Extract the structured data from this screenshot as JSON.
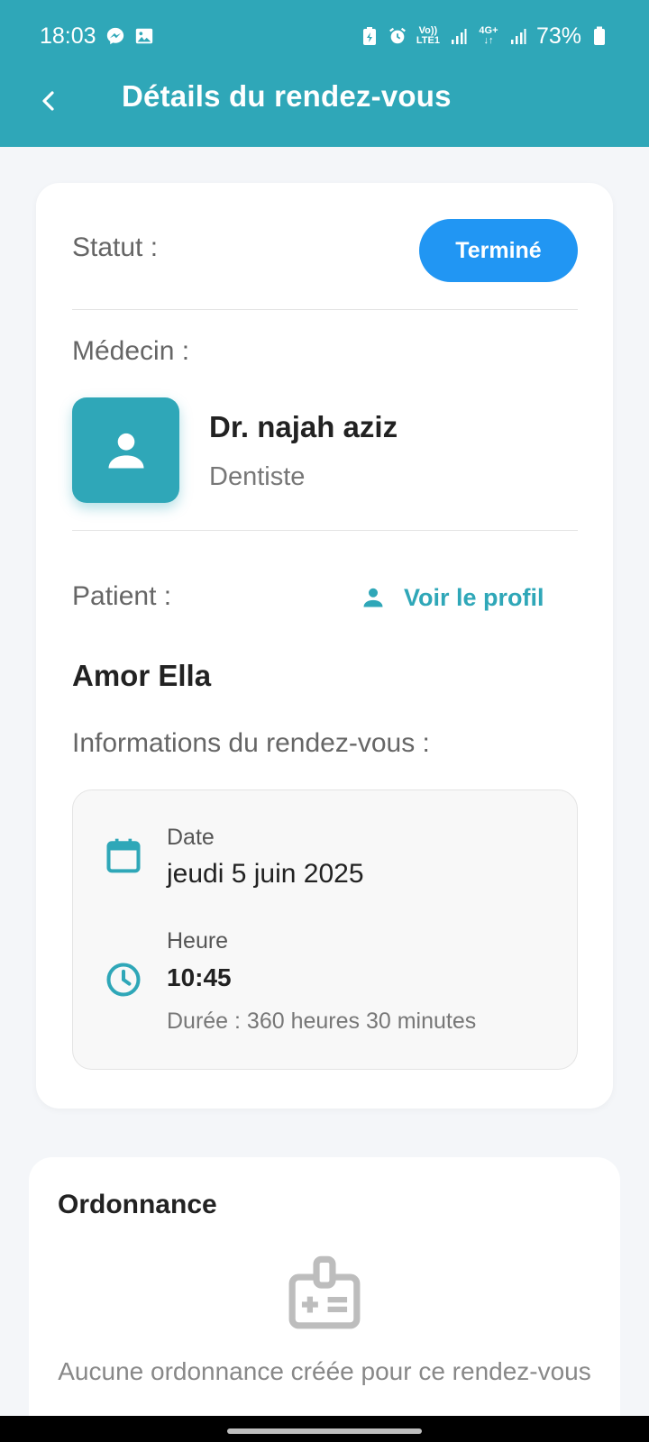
{
  "status_bar": {
    "time": "18:03",
    "left_icons": [
      "messenger-icon",
      "gallery-icon"
    ],
    "right_icons": [
      "battery-saver-icon",
      "alarm-icon",
      "volte-icon",
      "signal-icon",
      "4g-icon",
      "signal-icon"
    ],
    "volte_label_top": "Vo))",
    "volte_label_bottom": "LTE1",
    "net_label": "4G+",
    "battery": "73%"
  },
  "header": {
    "title": "Détails du rendez-vous",
    "back_icon": "arrow-back-icon",
    "color": "#2fa7b8"
  },
  "appointment": {
    "status_label": "Statut :",
    "status_value": "Terminé",
    "status_color": "#2196f3",
    "doctor_label": "Médecin :",
    "doctor_name": "Dr. najah aziz",
    "doctor_specialty": "Dentiste",
    "patient_label": "Patient :",
    "profile_link": "Voir le profil",
    "patient_name": "Amor Ella",
    "info_title": "Informations du rendez-vous :",
    "date_label": "Date",
    "date_value": "jeudi 5 juin 2025",
    "time_label": "Heure",
    "time_value": "10:45",
    "duration": "Durée : 360 heures 30 minutes"
  },
  "prescription": {
    "title": "Ordonnance",
    "icon": "prescription-badge-icon",
    "empty_message": "Aucune ordonnance créée pour ce rendez-vous"
  }
}
